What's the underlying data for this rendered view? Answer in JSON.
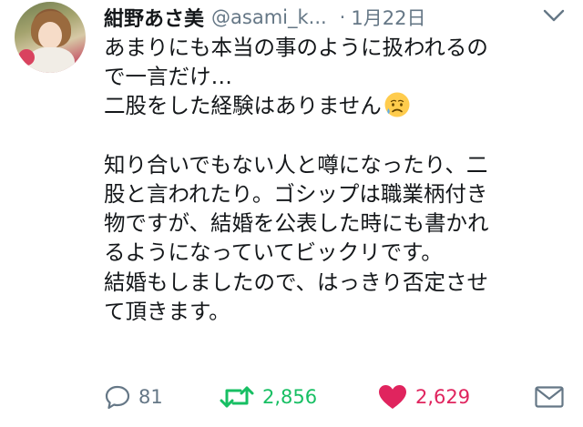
{
  "tweet": {
    "display_name": "紺野あさ美",
    "handle": "@asami_k...",
    "separator": "·",
    "timestamp": "1月22日",
    "lines": [
      "あまりにも本当の事のように扱われるの",
      "で一言だけ…",
      "二股をした経験はありません",
      "",
      "知り合いでもない人と噂になったり、二",
      "股と言われたり。ゴシップは職業柄付き",
      "物ですが、結婚を公表した時にも書かれ",
      "るようになっていてビックリです。",
      "結婚もしましたので、はっきり否定させ",
      "て頂きます。"
    ],
    "emoji": "sad-but-relieved-face-emoji"
  },
  "actions": {
    "reply_count": "81",
    "retweet_count": "2,856",
    "like_count": "2,629",
    "retweet_color": "#17bf63",
    "like_color": "#e0245e",
    "icon_color": "#657786"
  }
}
